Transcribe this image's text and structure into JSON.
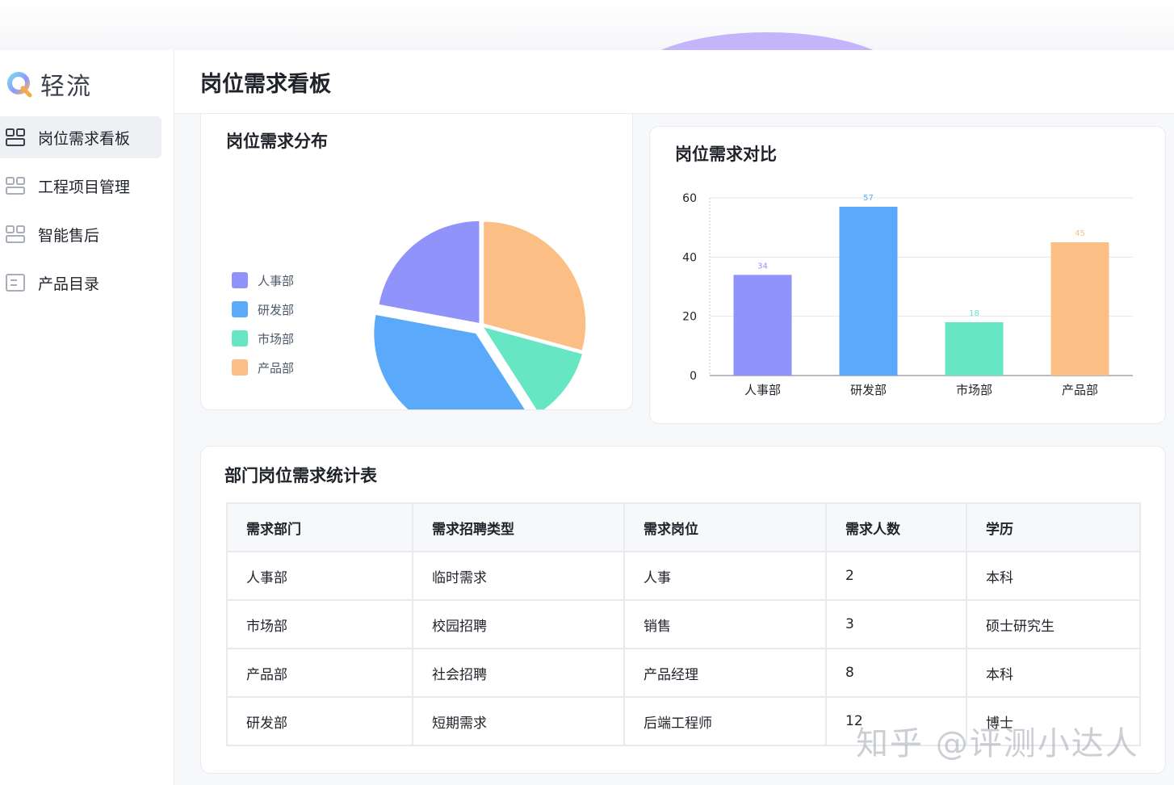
{
  "app": {
    "name": "轻流"
  },
  "sidebar": {
    "items": [
      {
        "label": "岗位需求看板",
        "icon": "dashboard-icon",
        "active": true
      },
      {
        "label": "工程项目管理",
        "icon": "dashboard-icon",
        "active": false
      },
      {
        "label": "智能售后",
        "icon": "dashboard-icon",
        "active": false
      },
      {
        "label": "产品目录",
        "icon": "list-icon",
        "active": false
      }
    ]
  },
  "header": {
    "title": "岗位需求看板"
  },
  "pie_card": {
    "title": "岗位需求分布"
  },
  "bar_card": {
    "title": "岗位需求对比"
  },
  "chart_data": [
    {
      "type": "pie",
      "title": "岗位需求分布",
      "legend_position": "left",
      "categories": [
        "人事部",
        "研发部",
        "市场部",
        "产品部"
      ],
      "values": [
        34,
        57,
        18,
        45
      ],
      "exploded": [
        "研发部"
      ],
      "colors": [
        "#8f93fa",
        "#5aa9fb",
        "#67e6c4",
        "#fbbf85"
      ]
    },
    {
      "type": "bar",
      "title": "岗位需求对比",
      "categories": [
        "人事部",
        "研发部",
        "市场部",
        "产品部"
      ],
      "values": [
        34,
        57,
        18,
        45
      ],
      "data_labels": [
        "34",
        "57",
        "18",
        "45"
      ],
      "ylim": [
        0,
        60
      ],
      "yticks": [
        "0",
        "20",
        "40",
        "60"
      ],
      "grid": true,
      "colors": [
        "#8f93fa",
        "#5aa9fb",
        "#67e6c4",
        "#fbbf85"
      ]
    }
  ],
  "table": {
    "title": "部门岗位需求统计表",
    "columns": [
      "需求部门",
      "需求招聘类型",
      "需求岗位",
      "需求人数",
      "学历"
    ],
    "rows": [
      [
        "人事部",
        "临时需求",
        "人事",
        "2",
        "本科"
      ],
      [
        "市场部",
        "校园招聘",
        "销售",
        "3",
        "硕士研究生"
      ],
      [
        "产品部",
        "社会招聘",
        "产品经理",
        "8",
        "本科"
      ],
      [
        "研发部",
        "短期需求",
        "后端工程师",
        "12",
        "博士"
      ]
    ]
  },
  "watermark": "知乎 @评测小达人"
}
